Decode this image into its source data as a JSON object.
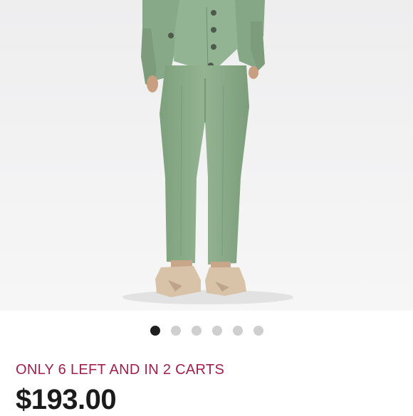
{
  "product": {
    "image": {
      "icon": "product-photo",
      "garment_color": "#8eaf8c",
      "shoe_color": "#d8c2a8"
    },
    "gallery": {
      "dot_count": 6,
      "active_index": 0
    },
    "stock_notice": "ONLY 6 LEFT AND IN 2 CARTS",
    "price": "$193.00"
  },
  "colors": {
    "stock_notice": "#a31f4b",
    "price": "#1b1b1b",
    "active_dot": "#1f1f1f",
    "inactive_dot": "#cfcfcf"
  }
}
